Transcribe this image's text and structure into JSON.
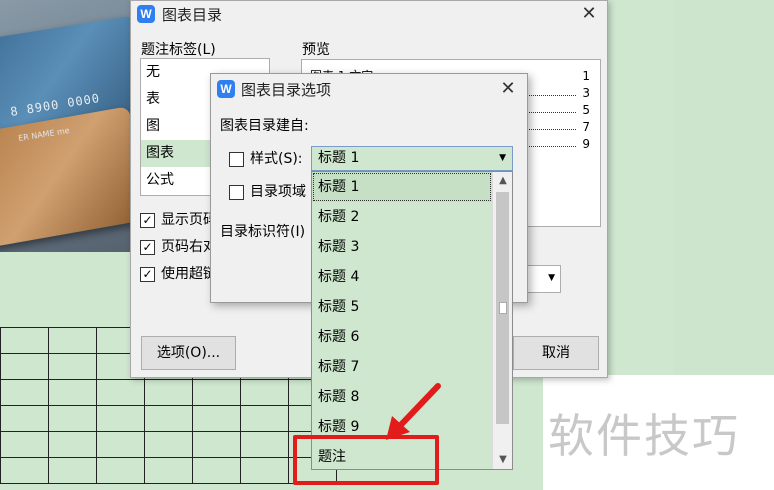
{
  "background": {
    "card_photo": {
      "number": "8 8900 0000",
      "name": "ER NAME",
      "name_suffix": "me"
    },
    "watermark": "软件技巧"
  },
  "main_dialog": {
    "title": "图表目录",
    "caption_label_text": "题注标签(L)",
    "caption_labels": [
      "无",
      "表",
      "图",
      "图表",
      "公式"
    ],
    "selected_caption_index": 3,
    "preview_label": "预览",
    "preview_lines": [
      {
        "text": "图表  1 文字",
        "page": "1"
      },
      {
        "text": "",
        "page": "3"
      },
      {
        "text": "",
        "page": "5"
      },
      {
        "text": "",
        "page": "7"
      },
      {
        "text": "",
        "page": "9"
      }
    ],
    "checkbox_show_page": {
      "label": "显示页码",
      "checked": true
    },
    "checkbox_right_align": {
      "label": "页码右对",
      "checked": true
    },
    "checkbox_hyperlink": {
      "label": "使用超链",
      "checked": true
    },
    "options_button": "选项(O)...",
    "cancel_button": "取消"
  },
  "options_dialog": {
    "title": "图表目录选项",
    "build_from_label": "图表目录建自:",
    "style_checkbox": {
      "label": "样式(S):",
      "checked": false
    },
    "style_selected": "标题 1",
    "field_checkbox": {
      "label": "目录项域",
      "checked": false
    },
    "identifier_label": "目录标识符(I)",
    "style_options": [
      "标题 1",
      "标题 2",
      "标题 3",
      "标题 4",
      "标题 5",
      "标题 6",
      "标题 7",
      "标题 8",
      "标题 9",
      "题注"
    ],
    "highlighted_option_index": 0
  },
  "icons": {
    "app_icon_glyph": "W",
    "close_glyph": "✕",
    "dropdown_arrow": "▼",
    "scroll_up": "▲",
    "scroll_down": "▼",
    "check_glyph": "✓"
  },
  "colors": {
    "accent_blue": "#2f7ff0",
    "annotation_red": "#e21b1b",
    "eye_care_green": "#cfe6cf"
  }
}
